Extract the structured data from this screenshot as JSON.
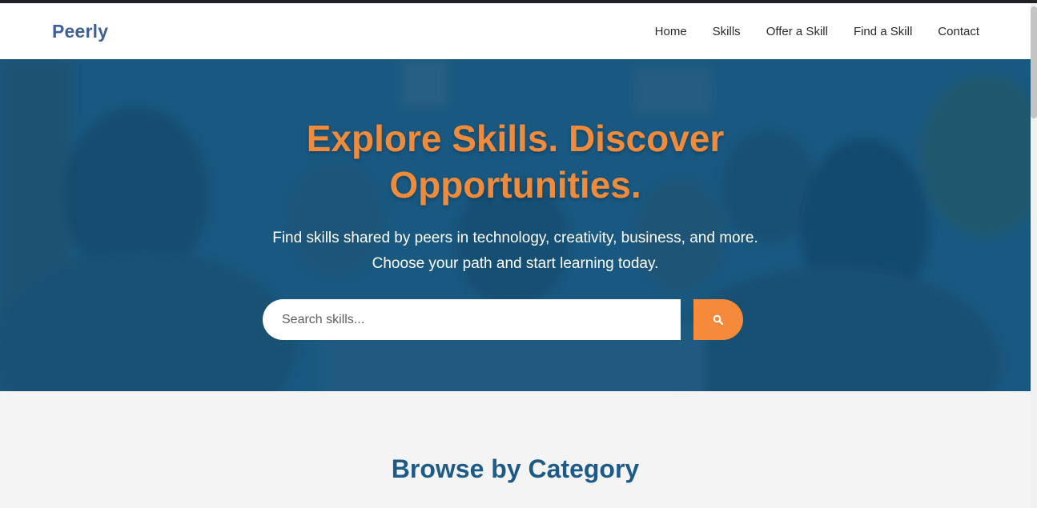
{
  "navbar": {
    "logo": "Peerly",
    "links": [
      "Home",
      "Skills",
      "Offer a Skill",
      "Find a Skill",
      "Contact"
    ]
  },
  "hero": {
    "title_line1": "Explore Skills. Discover",
    "title_line2": "Opportunities.",
    "subtitle_line1": "Find skills shared by peers in technology, creativity, business, and more.",
    "subtitle_line2": "Choose your path and start learning today.",
    "search_placeholder": "Search skills..."
  },
  "section": {
    "browse_title": "Browse by Category"
  },
  "colors": {
    "brand": "#3f5f99",
    "accent": "#f58a3b",
    "hero_overlay": "#16608c",
    "heading": "#1d5a87"
  },
  "icons": {
    "search": "search-icon"
  }
}
